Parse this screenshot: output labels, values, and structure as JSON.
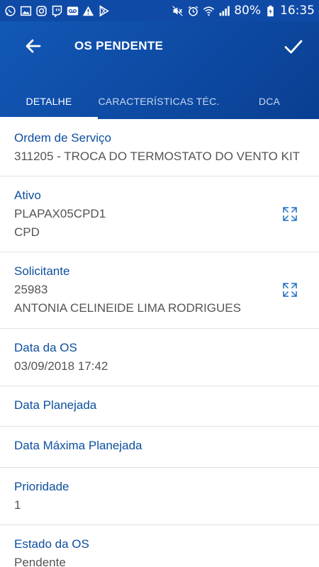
{
  "status_bar": {
    "left_icons": [
      "whatsapp-icon",
      "image-icon",
      "instagram-icon",
      "twitch-icon",
      "voicemail-icon",
      "warning-icon",
      "play-store-icon"
    ],
    "right_icons": [
      "mute-icon",
      "alarm-icon",
      "wifi-icon",
      "signal-icon"
    ],
    "battery": "80%",
    "time": "16:35"
  },
  "app_bar": {
    "title": "OS PENDENTE",
    "back_icon": "arrow-left-icon",
    "confirm_icon": "check-icon",
    "background": "#0f4aa6"
  },
  "tabs": [
    {
      "label": "DETALHE",
      "active": true
    },
    {
      "label": "CARACTERÍSTICAS TÉC.",
      "active": false
    },
    {
      "label": "DCA",
      "active": false
    }
  ],
  "fields": {
    "ordem": {
      "label": "Ordem de Serviço",
      "value": "311205 - TROCA DO TERMOSTATO DO VENTO KIT"
    },
    "ativo": {
      "label": "Ativo",
      "value_1": "PLAPAX05CPD1",
      "value_2": "CPD",
      "action_icon": "expand-icon"
    },
    "solicitante": {
      "label": "Solicitante",
      "value_1": "25983",
      "value_2": "ANTONIA CELINEIDE LIMA RODRIGUES",
      "action_icon": "expand-icon"
    },
    "data_os": {
      "label": "Data da OS",
      "value": "03/09/2018 17:42"
    },
    "data_planejada": {
      "label": "Data Planejada",
      "value": ""
    },
    "data_maxima": {
      "label": "Data Máxima Planejada",
      "value": ""
    },
    "prioridade": {
      "label": "Prioridade",
      "value": "1"
    },
    "estado": {
      "label": "Estado da OS",
      "value": "Pendente"
    }
  },
  "colors": {
    "accent": "#0d4f9e",
    "label": "#0d4f9e",
    "value": "#555555",
    "divider": "#e1e1e1"
  }
}
